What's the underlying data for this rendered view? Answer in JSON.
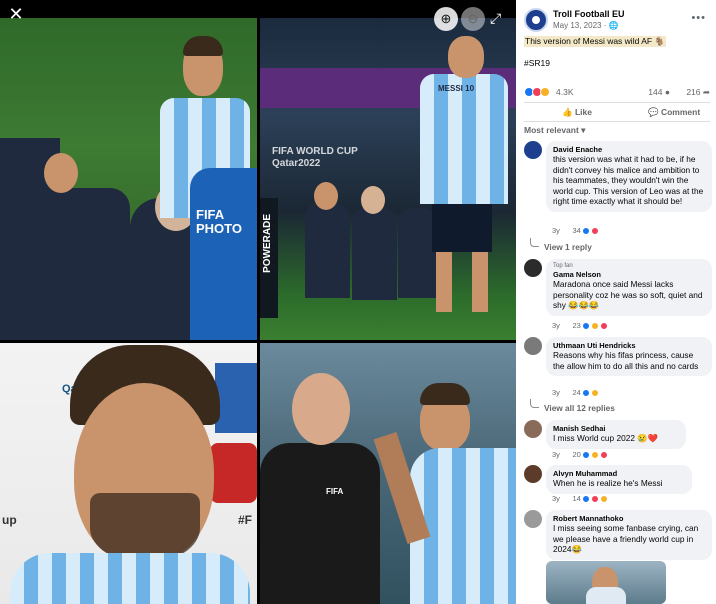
{
  "viewer": {
    "close_icon": "close-icon",
    "zoom_in_icon": "zoom-in-icon",
    "zoom_out_icon": "zoom-out-icon",
    "expand_icon": "expand-icon",
    "photos": [
      {
        "name": "messi-confrontation-photo",
        "overlay": "FIFA PHOTO"
      },
      {
        "name": "messi-ear-celebration-photo",
        "overlay": "FIFA WORLD CUP Qatar2022",
        "jersey_text": "MESSI 10",
        "board": "POWERADE"
      },
      {
        "name": "messi-interview-photo",
        "overlay": "Qatar",
        "side_text": "#F",
        "side_text2": "up"
      },
      {
        "name": "messi-referee-photo",
        "overlay": "FIFA"
      }
    ]
  },
  "post": {
    "page_name": "Troll Football EU",
    "date": "May 13, 2023 · ",
    "globe_icon": "globe-icon",
    "more_icon": "more-options-icon",
    "caption": "This version of Messi was wild AF 🐐",
    "hashtag": "#SR19",
    "reaction_count": "4.3K",
    "comment_count": "144",
    "share_count": "216",
    "like_label": "Like",
    "comment_label": "Comment",
    "sort_label": "Most relevant"
  },
  "comments": [
    {
      "badge": "",
      "name": "David Enache",
      "text": "this version was what it had to be, if he didn't convey his malice and ambition to his teammates, they wouldn't win the world cup. This version of Leo was at the right time exactly what it should be!",
      "age": "3y",
      "reactions": "34",
      "replies": "View 1 reply",
      "avatar_color": "#1d3f8e"
    },
    {
      "badge": "Top fan",
      "name": "Gama Nelson",
      "text": "Maradona once said Messi lacks personality coz he was so soft, quiet and shy 😂😂😂",
      "age": "3y",
      "reactions": "23",
      "replies": "",
      "avatar_color": "#2b2b2b"
    },
    {
      "badge": "",
      "name": "Uthmaan Uti Hendricks",
      "text": "Reasons why his fifas princess, cause the allow him to do all this and no cards",
      "age": "3y",
      "reactions": "24",
      "replies": "View all 12 replies",
      "avatar_color": "#7a7a7a"
    },
    {
      "badge": "",
      "name": "Manish Sedhai",
      "text": "I miss World cup 2022 😢❤️",
      "age": "3y",
      "reactions": "20",
      "replies": "",
      "avatar_color": "#8a6b5a"
    },
    {
      "badge": "",
      "name": "Alvyn Muhammad",
      "text": "When he is realize he's Messi",
      "age": "3y",
      "reactions": "14",
      "replies": "",
      "avatar_color": "#5c3b2a"
    },
    {
      "badge": "",
      "name": "Robert Mannathoko",
      "text": "I miss seeing some fanbase crying, can we please have a friendly world cup in 2024😂",
      "age": "",
      "reactions": "",
      "replies": "",
      "avatar_color": "#9a9a9a"
    }
  ],
  "colors": {
    "like": "#1877f2",
    "love": "#f33e58",
    "haha": "#f7b125",
    "bubble": "#f0f2f5"
  }
}
